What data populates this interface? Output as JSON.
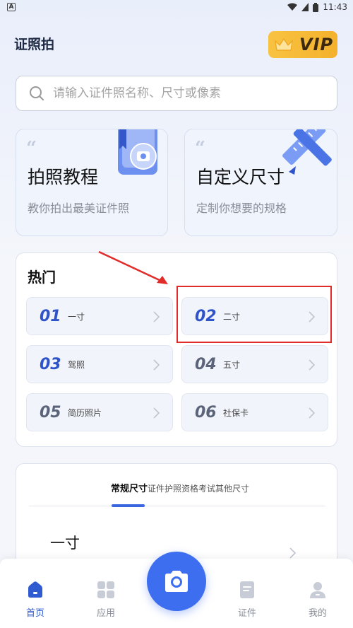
{
  "status_bar": {
    "time": "11:43",
    "left_indicator": "A"
  },
  "header": {
    "title": "证照拍",
    "vip_label": "VIP"
  },
  "search": {
    "placeholder": "请输入证件照名称、尺寸或像素"
  },
  "feature_cards": [
    {
      "title": "拍照教程",
      "subtitle": "教你拍出最美证件照"
    },
    {
      "title": "自定义尺寸",
      "subtitle": "定制你想要的规格"
    }
  ],
  "hot": {
    "title": "热门",
    "items": [
      {
        "num": "01",
        "label": "一寸"
      },
      {
        "num": "02",
        "label": "二寸"
      },
      {
        "num": "03",
        "label": "驾照"
      },
      {
        "num": "04",
        "label": "五寸"
      },
      {
        "num": "05",
        "label": "简历照片"
      },
      {
        "num": "06",
        "label": "社保卡"
      }
    ]
  },
  "tabs": {
    "items": [
      "常规尺寸",
      "证件护照",
      "资格考试",
      "其他尺寸"
    ],
    "active_index": 0,
    "first_row": "一寸"
  },
  "bottom_nav": [
    {
      "label": "首页",
      "icon": "home-icon",
      "active": true
    },
    {
      "label": "应用",
      "icon": "apps-icon",
      "active": false
    },
    {
      "label": "证件",
      "icon": "document-icon",
      "active": false
    },
    {
      "label": "我的",
      "icon": "profile-icon",
      "active": false
    }
  ],
  "colors": {
    "accent": "#3d6ef0",
    "vip": "#f6bb35",
    "annotation": "#e12b2b"
  }
}
